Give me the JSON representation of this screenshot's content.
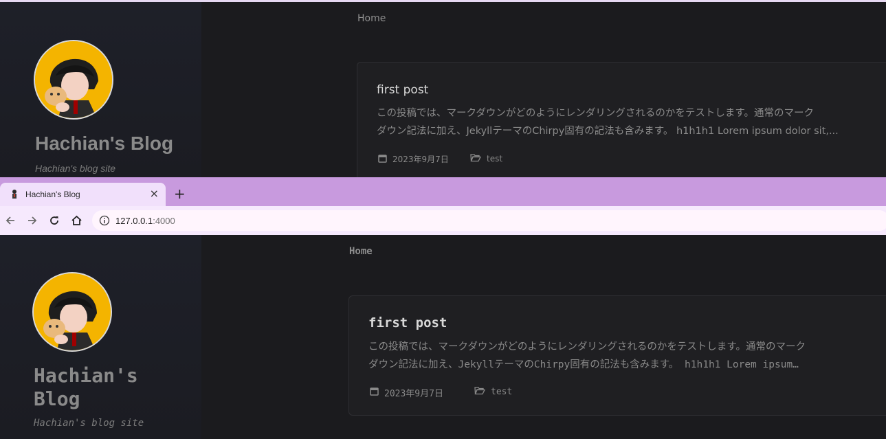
{
  "blog": {
    "breadcrumb": "Home",
    "site_title": "Hachian's Blog",
    "site_title_line1": "Hachian's",
    "site_title_line2": "Blog",
    "site_subtitle": "Hachian's blog site",
    "post": {
      "title": "first post",
      "excerpt_line1": "この投稿では、マークダウンがどのようにレンダリングされるのかをテストします。通常のマーク",
      "excerpt_line2_top": "ダウン記法に加え、JekyllテーマのChirpy固有の記法も含みます。 h1h1h1 Lorem ipsum dolor sit,...",
      "excerpt_line2_bottom": "ダウン記法に加え、JekyllテーマのChirpy固有の記法も含みます。 h1h1h1 Lorem ipsum…",
      "date": "2023年9月7日",
      "category": "test"
    }
  },
  "browser": {
    "tab_title": "Hachian's Blog",
    "tab_close": "×",
    "new_tab": "+",
    "url_host": "127.0.0.1",
    "url_port": ":4000"
  },
  "icons": {
    "calendar": "calendar-icon",
    "folder": "folder-open-icon",
    "back": "arrow-left-icon",
    "forward": "arrow-right-icon",
    "reload": "reload-icon",
    "home": "home-icon",
    "info": "info-icon"
  },
  "colors": {
    "page_bg": "#1b1b1e",
    "chrome_accent": "#c89ade",
    "tab_bg": "#f1e0fb"
  }
}
